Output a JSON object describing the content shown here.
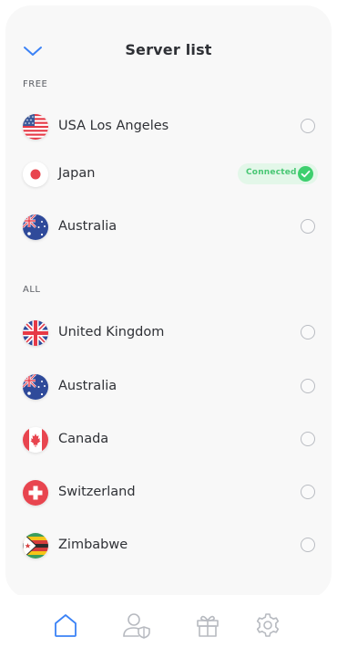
{
  "header": {
    "title": "Server list",
    "collapse_icon": "chevron-down-icon"
  },
  "sections": {
    "free_label": "FREE",
    "all_label": "ALL"
  },
  "free_servers": [
    {
      "name": "USA Los Angeles",
      "flag": "usa-flag-icon",
      "status": "unselected"
    },
    {
      "name": "Japan",
      "flag": "japan-flag-icon",
      "status": "connected",
      "badge": "Connected"
    },
    {
      "name": "Australia",
      "flag": "australia-flag-icon",
      "status": "unselected"
    }
  ],
  "all_servers": [
    {
      "name": "United Kingdom",
      "flag": "uk-flag-icon",
      "status": "unselected"
    },
    {
      "name": "Australia",
      "flag": "australia-flag-icon",
      "status": "unselected"
    },
    {
      "name": "Canada",
      "flag": "canada-flag-icon",
      "status": "unselected"
    },
    {
      "name": "Switzerland",
      "flag": "switzerland-flag-icon",
      "status": "unselected"
    },
    {
      "name": "Zimbabwe",
      "flag": "zimbabwe-flag-icon",
      "status": "unselected"
    }
  ],
  "tabbar": {
    "tabs": [
      {
        "icon": "home-icon",
        "active": true
      },
      {
        "icon": "user-shield-icon",
        "active": false
      },
      {
        "icon": "gift-icon",
        "active": false
      },
      {
        "icon": "settings-icon",
        "active": false
      }
    ]
  },
  "colors": {
    "accent": "#3b82f6",
    "connected_bg": "#e3f7e9",
    "connected_text": "#48c774",
    "inactive_icon": "#b7bac0"
  }
}
